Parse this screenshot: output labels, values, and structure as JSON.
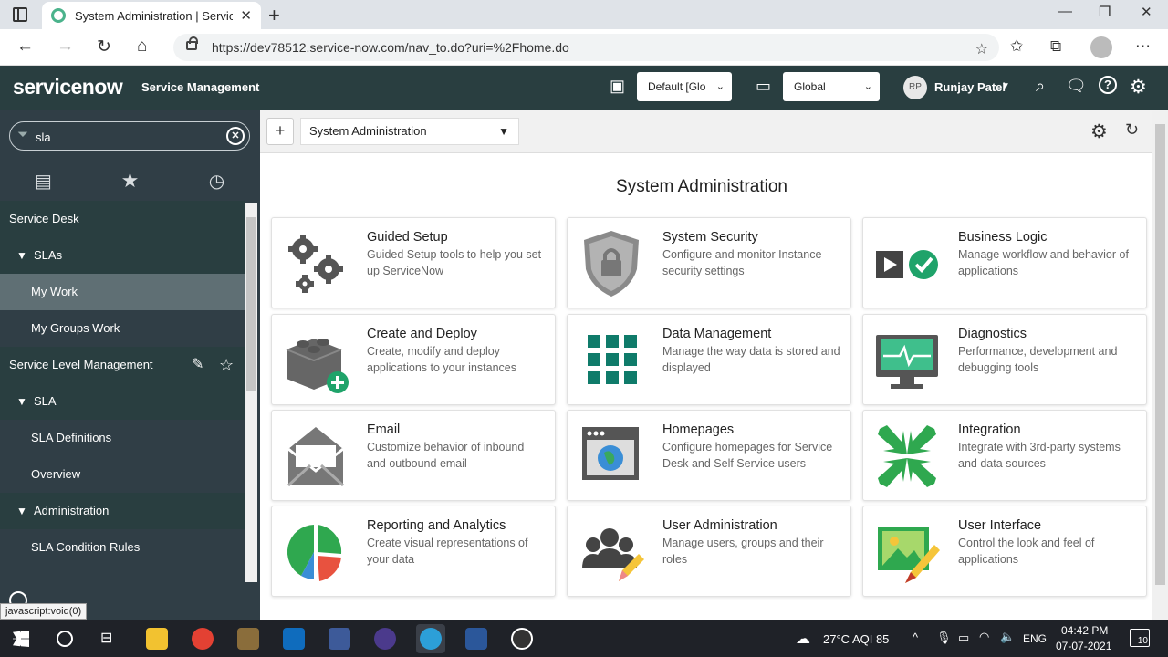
{
  "browser": {
    "tab_title": "System Administration | ServiceNow",
    "url": "https://dev78512.service-now.com/nav_to.do?uri=%2Fhome.do"
  },
  "header": {
    "logo": "servicenow",
    "product": "Service Management",
    "update_set": "Default [Glo",
    "application_scope": "Global",
    "user_initials": "RP",
    "user_name": "Runjay Patel"
  },
  "navigator": {
    "filter_value": "sla",
    "items": [
      {
        "label": "Service Desk",
        "kind": "section"
      },
      {
        "label": "SLAs",
        "kind": "group"
      },
      {
        "label": "My Work",
        "kind": "module"
      },
      {
        "label": "My Groups Work",
        "kind": "module"
      },
      {
        "label": "Service Level Management",
        "kind": "section"
      },
      {
        "label": "SLA",
        "kind": "group"
      },
      {
        "label": "SLA Definitions",
        "kind": "module"
      },
      {
        "label": "Overview",
        "kind": "module"
      },
      {
        "label": "Administration",
        "kind": "group"
      },
      {
        "label": "SLA Condition Rules",
        "kind": "module"
      }
    ],
    "status_tooltip": "javascript:void(0)"
  },
  "content": {
    "dashboard_select": "System Administration",
    "page_title": "System Administration",
    "cards": [
      {
        "title": "Guided Setup",
        "desc": "Guided Setup tools to help you set up ServiceNow",
        "icon": "gears-icon"
      },
      {
        "title": "System Security",
        "desc": "Configure and monitor Instance security settings",
        "icon": "shield-lock-icon"
      },
      {
        "title": "Business Logic",
        "desc": "Manage workflow and behavior of applications",
        "icon": "play-check-icon"
      },
      {
        "title": "Create and Deploy",
        "desc": "Create, modify and deploy applications to your instances",
        "icon": "blocks-add-icon"
      },
      {
        "title": "Data Management",
        "desc": "Manage the way data is stored and displayed",
        "icon": "grid-icon"
      },
      {
        "title": "Diagnostics",
        "desc": "Performance, development and debugging tools",
        "icon": "monitor-pulse-icon"
      },
      {
        "title": "Email",
        "desc": "Customize behavior of inbound and outbound email",
        "icon": "envelope-icon"
      },
      {
        "title": "Homepages",
        "desc": "Configure homepages for Service Desk and Self Service users",
        "icon": "browser-globe-icon"
      },
      {
        "title": "Integration",
        "desc": "Integrate with 3rd-party systems and data sources",
        "icon": "arrows-in-icon"
      },
      {
        "title": "Reporting and Analytics",
        "desc": "Create visual representations of your data",
        "icon": "pie-chart-icon"
      },
      {
        "title": "User Administration",
        "desc": "Manage users, groups and their roles",
        "icon": "users-pencil-icon"
      },
      {
        "title": "User Interface",
        "desc": "Control the look and feel of applications",
        "icon": "picture-brush-icon"
      }
    ]
  },
  "taskbar": {
    "weather": "27°C AQI 85",
    "language": "ENG",
    "time": "04:42 PM",
    "date": "07-07-2021",
    "notifications": "10"
  },
  "colors": {
    "header_bg": "#293e40",
    "navigator_bg": "#303e46",
    "accent_green": "#1fa36a"
  }
}
